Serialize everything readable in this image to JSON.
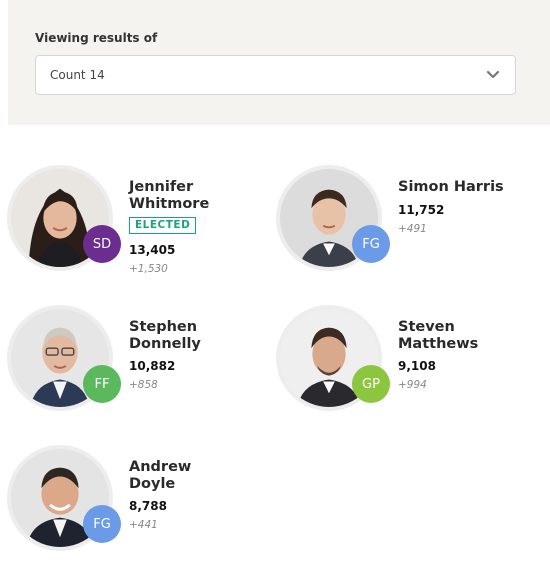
{
  "filter": {
    "label": "Viewing results of",
    "selected": "Count 14"
  },
  "colors": {
    "SD": "#6b2d8f",
    "FG": "#6b9be6",
    "FF": "#5cb85c",
    "GP": "#8cc63f",
    "elected": "#1aa37a"
  },
  "candidates": [
    {
      "name": "Jennifer\nWhitmore",
      "party": "SD",
      "status": "ELECTED",
      "votes": "13,405",
      "transfer": "+1,530"
    },
    {
      "name": "Simon Harris",
      "party": "FG",
      "votes": "11,752",
      "transfer": "+491"
    },
    {
      "name": "Stephen\nDonnelly",
      "party": "FF",
      "votes": "10,882",
      "transfer": "+858"
    },
    {
      "name": "Steven\nMatthews",
      "party": "GP",
      "votes": "9,108",
      "transfer": "+994"
    },
    {
      "name": "Andrew\nDoyle",
      "party": "FG",
      "votes": "8,788",
      "transfer": "+441"
    }
  ]
}
